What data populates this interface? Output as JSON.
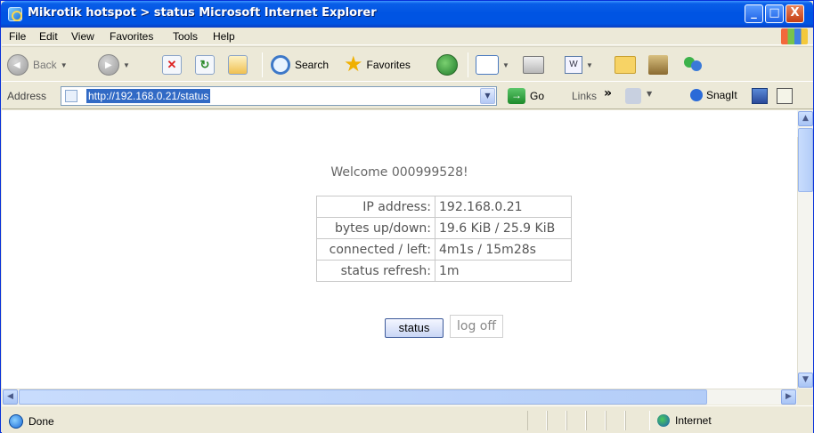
{
  "window": {
    "title": "Mikrotik hotspot > status  Microsoft Internet Explorer",
    "min_label": "_",
    "max_label": "□",
    "close_label": "X"
  },
  "menu": [
    "File",
    "Edit",
    "View",
    "Favorites",
    "Tools",
    "Help"
  ],
  "toolbar": {
    "back_label": "Back",
    "search_label": "Search",
    "favorites_label": "Favorites"
  },
  "address": {
    "label": "Address",
    "value": "http://192.168.0.21/status",
    "go_label": "Go",
    "links_label": "Links",
    "snagit_label": "SnagIt"
  },
  "page": {
    "welcome": "Welcome 000999528!",
    "rows": [
      {
        "label": "IP address:",
        "value": "192.168.0.21"
      },
      {
        "label": "bytes up/down:",
        "value": "19.6 KiB / 25.9 KiB"
      },
      {
        "label": "connected / left:",
        "value": "4m1s / 15m28s"
      },
      {
        "label": "status refresh:",
        "value": "1m"
      }
    ],
    "status_button": "status",
    "logoff_button": "log off"
  },
  "statusbar": {
    "left_text": "Done",
    "zone": "Internet"
  }
}
